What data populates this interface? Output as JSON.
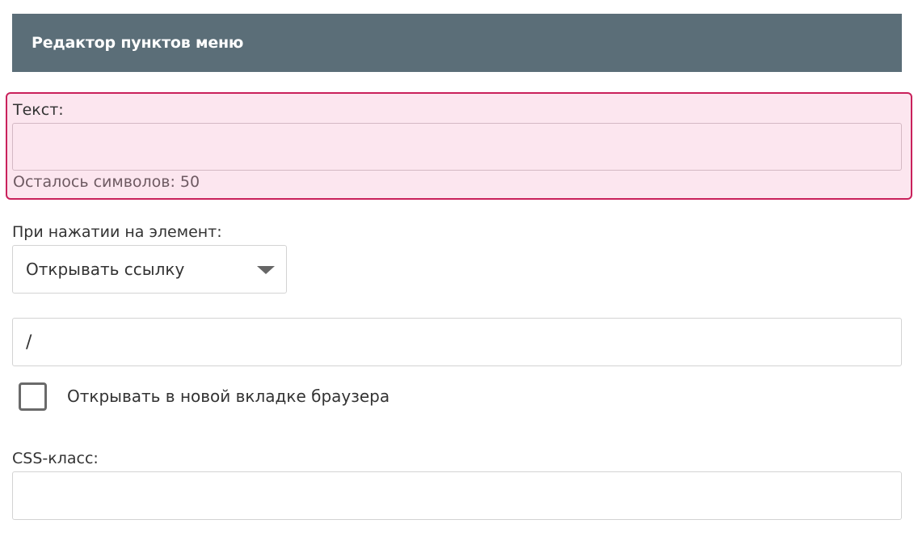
{
  "header": {
    "title": "Редактор пунктов меню"
  },
  "text_field": {
    "label": "Текст:",
    "value": "",
    "counter": "Осталось символов: 50",
    "state": "error"
  },
  "click_action": {
    "label": "При нажатии на элемент:",
    "selected": "Открывать ссылку",
    "icon": "chevron-down-icon"
  },
  "link_field": {
    "value": "/"
  },
  "new_tab": {
    "label": "Открывать в новой вкладке браузера",
    "checked": false
  },
  "css_class_field": {
    "label": "CSS-класс:",
    "value": ""
  },
  "colors": {
    "header_bg": "#5b6e78",
    "error_border": "#c9215b",
    "error_bg": "#fce6ef"
  }
}
